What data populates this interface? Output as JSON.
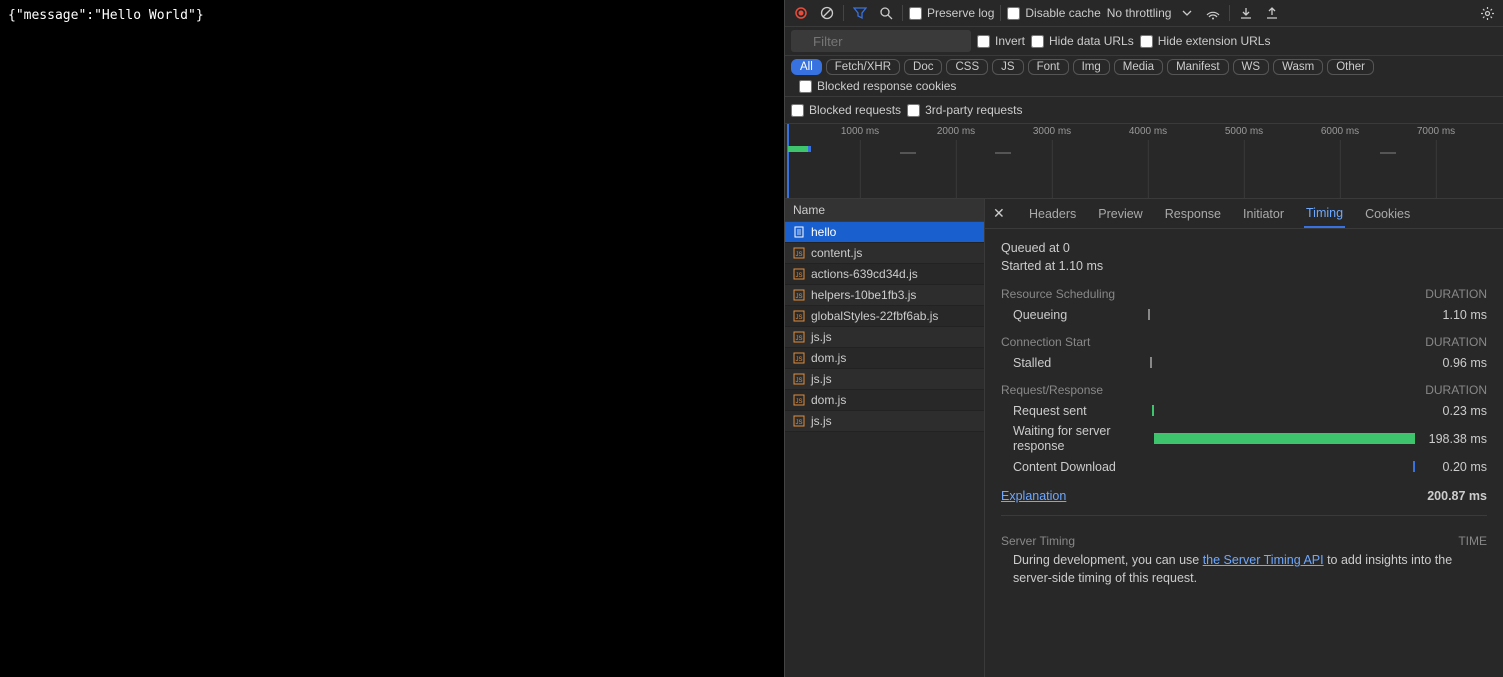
{
  "page_content": "{\"message\":\"Hello World\"}",
  "toolbar": {
    "preserve_log": "Preserve log",
    "disable_cache": "Disable cache",
    "throttling": "No throttling",
    "filter_placeholder": "Filter",
    "invert": "Invert",
    "hide_data_urls": "Hide data URLs",
    "hide_ext_urls": "Hide extension URLs",
    "blocked_cookies": "Blocked response cookies",
    "blocked_requests": "Blocked requests",
    "third_party": "3rd-party requests"
  },
  "filter_chips": [
    "All",
    "Fetch/XHR",
    "Doc",
    "CSS",
    "JS",
    "Font",
    "Img",
    "Media",
    "Manifest",
    "WS",
    "Wasm",
    "Other"
  ],
  "timeline_ticks": [
    "1000 ms",
    "2000 ms",
    "3000 ms",
    "4000 ms",
    "5000 ms",
    "6000 ms",
    "7000 ms"
  ],
  "list_header": "Name",
  "requests": [
    {
      "name": "hello",
      "type": "doc"
    },
    {
      "name": "content.js",
      "type": "js"
    },
    {
      "name": "actions-639cd34d.js",
      "type": "js"
    },
    {
      "name": "helpers-10be1fb3.js",
      "type": "js"
    },
    {
      "name": "globalStyles-22fbf6ab.js",
      "type": "js"
    },
    {
      "name": "js.js",
      "type": "js"
    },
    {
      "name": "dom.js",
      "type": "js"
    },
    {
      "name": "js.js",
      "type": "js"
    },
    {
      "name": "dom.js",
      "type": "js"
    },
    {
      "name": "js.js",
      "type": "js"
    }
  ],
  "detail_tabs": [
    "Headers",
    "Preview",
    "Response",
    "Initiator",
    "Timing",
    "Cookies"
  ],
  "timing": {
    "queued": "Queued at 0",
    "started": "Started at 1.10 ms",
    "duration_header": "DURATION",
    "resource_scheduling": "Resource Scheduling",
    "queueing": {
      "label": "Queueing",
      "value": "1.10 ms"
    },
    "connection_start": "Connection Start",
    "stalled": {
      "label": "Stalled",
      "value": "0.96 ms"
    },
    "request_response": "Request/Response",
    "sent": {
      "label": "Request sent",
      "value": "0.23 ms"
    },
    "waiting": {
      "label": "Waiting for server response",
      "value": "198.38 ms"
    },
    "download": {
      "label": "Content Download",
      "value": "0.20 ms"
    },
    "explanation": "Explanation",
    "total": "200.87 ms",
    "server_timing": "Server Timing",
    "time_header": "TIME",
    "server_note_pre": "During development, you can use ",
    "server_link": "the Server Timing API",
    "server_note_post": " to add insights into the server-side timing of this request."
  }
}
